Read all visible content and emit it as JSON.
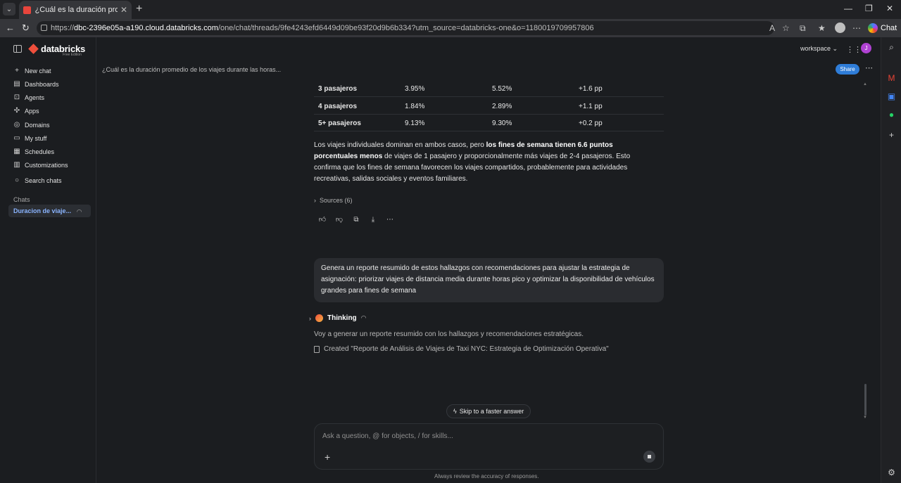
{
  "browser": {
    "tab_title": "¿Cuál es la duración promedio de",
    "url_prefix": "https://",
    "url_host": "dbc-2396e05a-a190.cloud.databricks.com",
    "url_path": "/one/chat/threads/9fe4243efd6449d09be93f20d9b6b334?utm_source=databricks-one&o=1180019709957806",
    "chat_label": "Chat"
  },
  "app": {
    "brand": "databricks",
    "brand_sub": "Free Edition",
    "workspace_label": "workspace",
    "user_initial": "J",
    "conversation_title": "¿Cuál es la duración promedio de los viajes durante las horas...",
    "share_label": "Share"
  },
  "sidebar": {
    "items": [
      {
        "label": "New chat",
        "icon": "plus-icon"
      },
      {
        "label": "Dashboards",
        "icon": "dashboard-icon"
      },
      {
        "label": "Agents",
        "icon": "agent-icon"
      },
      {
        "label": "Apps",
        "icon": "apps-icon"
      },
      {
        "label": "Domains",
        "icon": "domain-icon"
      },
      {
        "label": "My stuff",
        "icon": "folder-icon"
      },
      {
        "label": "Schedules",
        "icon": "calendar-icon"
      },
      {
        "label": "Customizations",
        "icon": "library-icon"
      },
      {
        "label": "Search chats",
        "icon": "search-icon"
      }
    ],
    "section_label": "Chats",
    "active_chat": "Duracion de viaje..."
  },
  "table": {
    "rows": [
      [
        "3 pasajeros",
        "3.95%",
        "5.52%",
        "+1.6 pp"
      ],
      [
        "4 pasajeros",
        "1.84%",
        "2.89%",
        "+1.1 pp"
      ],
      [
        "5+ pasajeros",
        "9.13%",
        "9.30%",
        "+0.2 pp"
      ]
    ]
  },
  "answer": {
    "p_start": "Los viajes individuales dominan en ambos casos, pero ",
    "p_bold": "los fines de semana tienen 6.6 puntos porcentuales menos",
    "p_end": " de viajes de 1 pasajero y proporcionalmente más viajes de 2-4 pasajeros. Esto confirma que los fines de semana favorecen los viajes compartidos, probablemente para actividades recreativas, salidas sociales y eventos familiares.",
    "sources_label": "Sources (6)"
  },
  "user_message": "Genera un reporte resumido de estos hallazgos con recomendaciones para ajustar la estrategia de asignación: priorizar viajes de distancia media durante horas pico y optimizar la disponibilidad de vehículos grandes para fines de semana",
  "assistant": {
    "thinking_label": "Thinking",
    "status_text": "Voy a generar un reporte resumido con los hallazgos y recomendaciones estratégicas.",
    "created_text": "Created \"Reporte de Análisis de Viajes de Taxi NYC: Estrategia de Optimización Operativa\""
  },
  "composer": {
    "skip_label": "Skip to a faster answer",
    "placeholder": "Ask a question, @ for objects, / for skills...",
    "disclaimer": "Always review the accuracy of responses."
  },
  "colors": {
    "accent": "#2f7dd8",
    "brand": "#ef4f3c",
    "background": "#1b1d20"
  }
}
